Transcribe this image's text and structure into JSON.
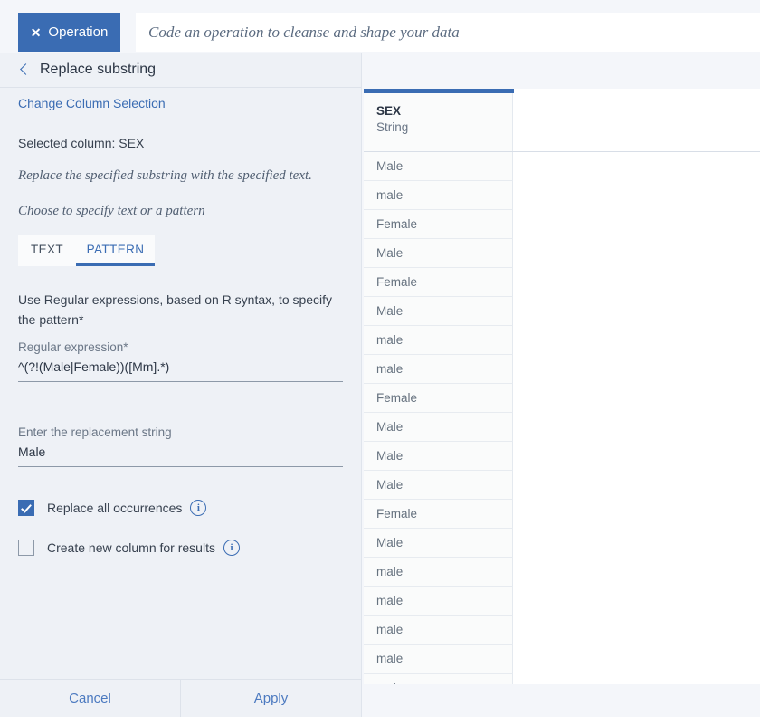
{
  "topbar": {
    "operation_button_label": "Operation",
    "operation_close_glyph": "✕",
    "omnibar_placeholder": "Code an operation to cleanse and shape your data"
  },
  "panel": {
    "title": "Replace substring",
    "back_icon": "chevron-left-icon",
    "change_column_link": "Change Column Selection",
    "selected_column": "Selected column: SEX",
    "description": "Replace the specified substring with the specified text.",
    "choose_hint": "Choose to specify text or a pattern",
    "tabs": [
      {
        "label": "TEXT",
        "active": false
      },
      {
        "label": "PATTERN",
        "active": true
      }
    ],
    "pattern_help": "Use Regular expressions, based on R syntax, to specify the pattern*",
    "regex_field": {
      "label": "Regular expression*",
      "value": "^(?!(Male|Female))([Mm].*)"
    },
    "replacement_field": {
      "label": "Enter the replacement string",
      "value": "Male"
    },
    "options": [
      {
        "label": "Replace all occurrences",
        "checked": true,
        "info_icon": "info-icon"
      },
      {
        "label": "Create new column for results",
        "checked": false,
        "info_icon": "info-icon"
      }
    ],
    "footer": {
      "cancel_label": "Cancel",
      "apply_label": "Apply"
    }
  },
  "grid": {
    "column": {
      "name": "SEX",
      "type": "String"
    },
    "accent_color": "#3a6cb3",
    "rows": [
      "Male",
      "male",
      "Female",
      "Male",
      "Female",
      "Male",
      "male",
      "male",
      "Female",
      "Male",
      "Male",
      "Male",
      "Female",
      "Male",
      "male",
      "male",
      "male",
      "male",
      "male"
    ]
  },
  "colors": {
    "accent": "#3a6cb3",
    "panel_bg": "#eef1f6",
    "link": "#4c7ac0"
  }
}
